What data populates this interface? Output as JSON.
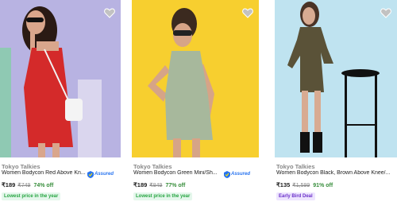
{
  "products": [
    {
      "brand": "Tokyo Talkies",
      "title": "Women Bodycon Red Above Kn...",
      "price": "₹189",
      "mrp": "₹749",
      "discount": "74% off",
      "assured": "Assured",
      "tag": "Lowest price in the year",
      "tag_color": "#26a541",
      "background": "#b8b3e2"
    },
    {
      "brand": "Tokyo Talkies",
      "title": "Women Bodycon Green Mini/Sh...",
      "price": "₹189",
      "mrp": "₹849",
      "discount": "77% off",
      "assured": "Assured",
      "tag": "Lowest price in the year",
      "tag_color": "#26a541",
      "background": "#f7cf2f"
    },
    {
      "brand": "Tokyo Talkies",
      "title": "Women Bodycon Black, Brown Above Knee/...",
      "price": "₹135",
      "mrp": "₹1,599",
      "discount": "91% off",
      "tag": "Early Bird Deal",
      "tag_color": "#6b31c9",
      "background": "#bfe3f0"
    }
  ],
  "icons": {
    "wishlist": "heart-icon",
    "assured": "assured-badge-icon"
  },
  "colors": {
    "discount": "#388e3c",
    "assured": "#2874f0"
  }
}
